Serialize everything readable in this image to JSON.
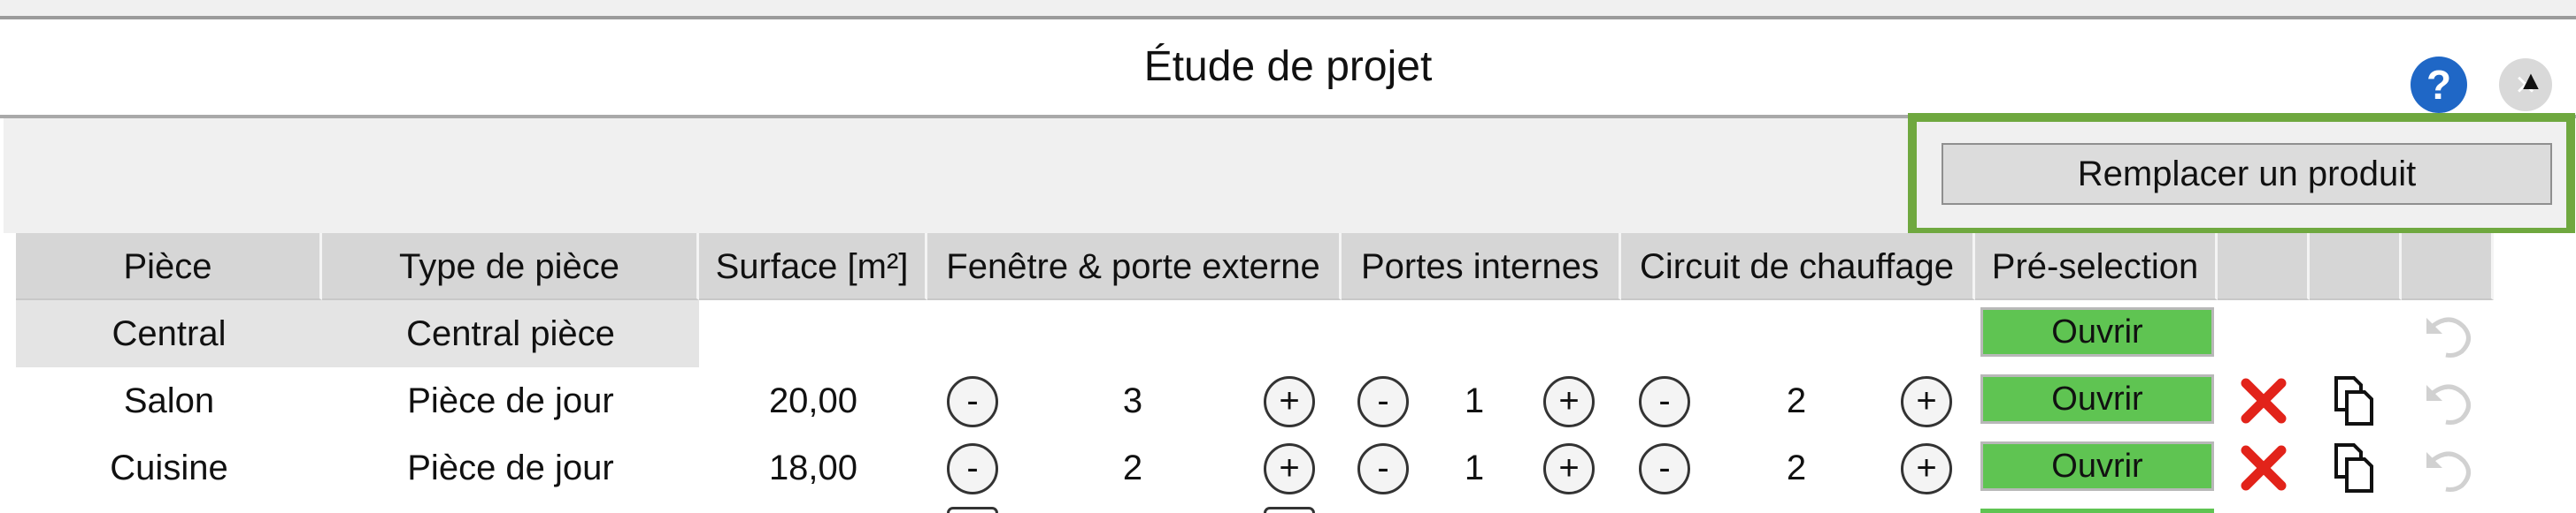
{
  "window": {
    "title": "Étude de projet",
    "help_label": "?",
    "close_label": "×"
  },
  "toolbar": {
    "replace_label": "Remplacer un produit"
  },
  "table": {
    "headers": [
      "Pièce",
      "Type de pièce",
      "Surface [m²]",
      "Fenêtre & porte externe",
      "Portes internes",
      "Circuit de chauffage",
      "Pré-selection",
      "",
      "",
      ""
    ],
    "rows": [
      {
        "piece": "Central",
        "type": "Central pièce",
        "surface": "",
        "fenetres": "",
        "portes": "",
        "circuit": "",
        "preselection": "Ouvrir",
        "central": true
      },
      {
        "piece": "Salon",
        "type": "Pièce de jour",
        "surface": "20,00",
        "fenetres": "3",
        "portes": "1",
        "circuit": "2",
        "preselection": "Ouvrir",
        "central": false
      },
      {
        "piece": "Cuisine",
        "type": "Pièce de jour",
        "surface": "18,00",
        "fenetres": "2",
        "portes": "1",
        "circuit": "2",
        "preselection": "Ouvrir",
        "central": false
      }
    ],
    "stepper": {
      "minus": "-",
      "plus": "+"
    }
  },
  "colors": {
    "accent_frame": "#6fa83f",
    "ouvrir_green": "#5fc452",
    "help_blue": "#1f67c6",
    "delete_red": "#e2231a"
  },
  "icons": [
    "help-icon",
    "close-icon",
    "delete-icon",
    "duplicate-icon",
    "undo-icon",
    "scroll-up-icon"
  ]
}
